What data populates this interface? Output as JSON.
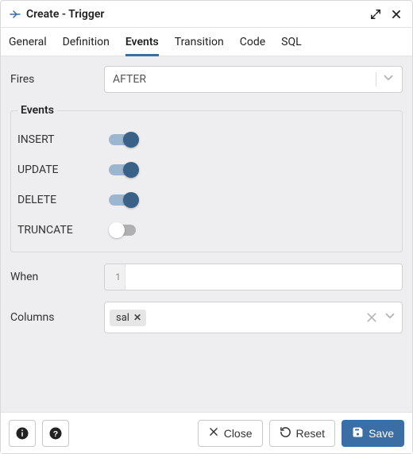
{
  "title": "Create - Trigger",
  "tabs": [
    "General",
    "Definition",
    "Events",
    "Transition",
    "Code",
    "SQL"
  ],
  "active_tab": "Events",
  "fires": {
    "label": "Fires",
    "value": "AFTER"
  },
  "events_section": {
    "legend": "Events",
    "items": [
      {
        "name": "INSERT",
        "on": true
      },
      {
        "name": "UPDATE",
        "on": true
      },
      {
        "name": "DELETE",
        "on": true
      },
      {
        "name": "TRUNCATE",
        "on": false
      }
    ]
  },
  "when": {
    "label": "When",
    "line_no": "1",
    "value": ""
  },
  "columns": {
    "label": "Columns",
    "chips": [
      "sal"
    ]
  },
  "footer": {
    "close": "Close",
    "reset": "Reset",
    "save": "Save"
  }
}
